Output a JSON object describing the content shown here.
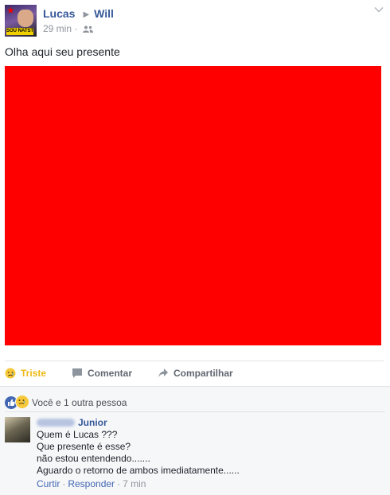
{
  "post": {
    "author": "Lucas",
    "target": "Will",
    "time": "29 min",
    "avatar_banner_text": "SOU NATSTA",
    "text": "Olha aqui seu presente",
    "image_color": "#ff0000"
  },
  "actions": {
    "reaction_label": "Triste",
    "comment_label": "Comentar",
    "share_label": "Compartilhar"
  },
  "feedback": {
    "reactions_summary": "Você e 1 outra pessoa"
  },
  "comment": {
    "author": "Junior",
    "lines": [
      "Quem é Lucas ???",
      "Que presente é esse?",
      "não estou entendendo.......",
      "Aguardo o retorno de ambos imediatamente......"
    ],
    "like_label": "Curtir",
    "reply_label": "Responder",
    "time": "7 min"
  },
  "colors": {
    "link": "#365899",
    "sad_reaction": "#f0ba15",
    "feedback_bg": "#f6f7f9"
  }
}
